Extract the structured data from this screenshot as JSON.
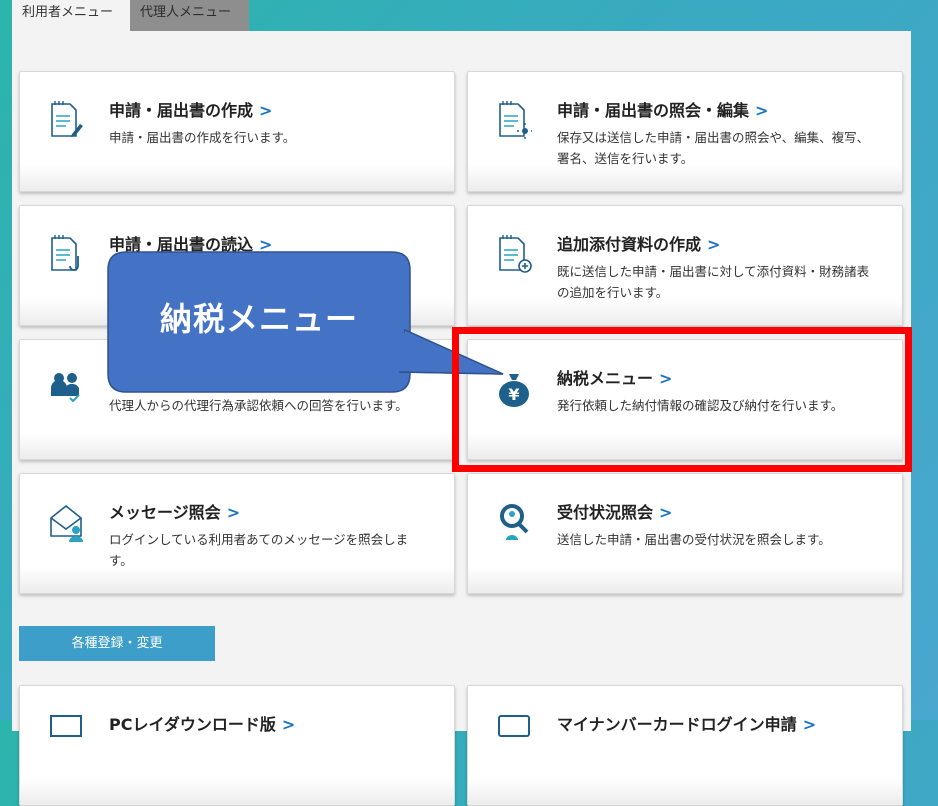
{
  "tabs": [
    {
      "label": "利用者メニュー",
      "active": true
    },
    {
      "label": "代理人メニュー",
      "active": false
    }
  ],
  "cards": [
    {
      "title": "申請・届出書の作成",
      "chevron": ">",
      "desc": "申請・届出書の作成を行います。",
      "icon": "document-pencil-icon"
    },
    {
      "title": "申請・届出書の照会・編集",
      "chevron": ">",
      "desc": "保存又は送信した申請・届出書の照会や、編集、複写、署名、送信を行います。",
      "icon": "document-search-icon"
    },
    {
      "title": "申請・届出書の読込",
      "chevron": ">",
      "desc": "",
      "icon": "document-import-icon"
    },
    {
      "title": "追加添付資料の作成",
      "chevron": ">",
      "desc": "既に送信した申請・届出書に対して添付資料・財務諸表の追加を行います。",
      "icon": "document-add-icon"
    },
    {
      "title": "",
      "chevron": "",
      "desc": "代理人からの代理行為承認依頼への回答を行います。",
      "icon": "users-check-icon"
    },
    {
      "title": "納税メニュー",
      "chevron": ">",
      "desc": "発行依頼した納付情報の確認及び納付を行います。",
      "icon": "yen-bag-icon"
    },
    {
      "title": "メッセージ照会",
      "chevron": ">",
      "desc": "ログインしている利用者あてのメッセージを照会します。",
      "icon": "envelope-user-icon"
    },
    {
      "title": "受付状況照会",
      "chevron": ">",
      "desc": "送信した申請・届出書の受付状況を照会します。",
      "icon": "search-person-icon"
    }
  ],
  "registration_button": "各種登録・変更",
  "bottom_cards": [
    {
      "title": "PCレイダウンロード版",
      "chevron": ">"
    },
    {
      "title": "マイナンバーカードログイン申請",
      "chevron": ">"
    }
  ],
  "callout": {
    "text": "納税メニュー",
    "color": "#4472c4"
  },
  "highlight_color": "#ff0000",
  "accent_color": "#1a73c4"
}
